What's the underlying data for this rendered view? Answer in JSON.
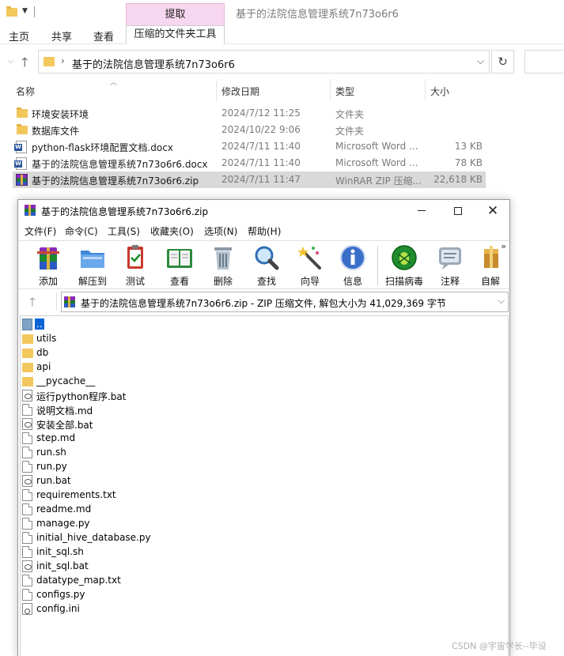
{
  "explorer": {
    "window_title": "基于的法院信息管理系统7n73o6r6",
    "context_tab": "提取",
    "ribbon_tabs": [
      "主页",
      "共享",
      "查看"
    ],
    "ribbon_active_tab": "压缩的文件夹工具",
    "address": "基于的法院信息管理系统7n73o6r6",
    "columns": {
      "name": "名称",
      "date": "修改日期",
      "type": "类型",
      "size": "大小"
    },
    "files": [
      {
        "name": "环境安装环境",
        "date": "2024/7/12 11:25",
        "type": "文件夹",
        "size": "",
        "icon": "folder-icon"
      },
      {
        "name": "数据库文件",
        "date": "2024/10/22 9:06",
        "type": "文件夹",
        "size": "",
        "icon": "folder-icon"
      },
      {
        "name": "python-flask环境配置文档.docx",
        "date": "2024/7/11 11:40",
        "type": "Microsoft Word ...",
        "size": "13 KB",
        "icon": "word-icon"
      },
      {
        "name": "基于的法院信息管理系统7n73o6r6.docx",
        "date": "2024/7/11 11:40",
        "type": "Microsoft Word ...",
        "size": "78 KB",
        "icon": "word-icon"
      },
      {
        "name": "基于的法院信息管理系统7n73o6r6.zip",
        "date": "2024/7/11 11:47",
        "type": "WinRAR ZIP 压缩...",
        "size": "22,618 KB",
        "icon": "winrar-icon",
        "selected": true
      }
    ]
  },
  "winrar": {
    "title": "基于的法院信息管理系统7n73o6r6.zip",
    "menu": [
      "文件(F)",
      "命令(C)",
      "工具(S)",
      "收藏夹(O)",
      "选项(N)",
      "帮助(H)"
    ],
    "toolbar": [
      {
        "label": "添加",
        "icon": "add-archive-icon"
      },
      {
        "label": "解压到",
        "icon": "extract-folder-icon"
      },
      {
        "label": "测试",
        "icon": "test-clipboard-icon"
      },
      {
        "label": "查看",
        "icon": "view-book-icon"
      },
      {
        "label": "删除",
        "icon": "trash-icon"
      },
      {
        "label": "查找",
        "icon": "magnifier-icon"
      },
      {
        "label": "向导",
        "icon": "wizard-wand-icon"
      },
      {
        "label": "信息",
        "icon": "info-icon"
      },
      {
        "label": "扫描病毒",
        "icon": "virus-scan-icon"
      },
      {
        "label": "注释",
        "icon": "comment-icon"
      },
      {
        "label": "自解",
        "icon": "sfx-icon"
      }
    ],
    "path": "基于的法院信息管理系统7n73o6r6.zip - ZIP 压缩文件, 解包大小为 41,029,369 字节",
    "entries": [
      {
        "name": "..",
        "kind": "up",
        "selected": true
      },
      {
        "name": "utils",
        "kind": "folder"
      },
      {
        "name": "db",
        "kind": "folder"
      },
      {
        "name": "api",
        "kind": "folder"
      },
      {
        "name": "__pycache__",
        "kind": "folder"
      },
      {
        "name": "运行python程序.bat",
        "kind": "bat"
      },
      {
        "name": "说明文档.md",
        "kind": "file"
      },
      {
        "name": "安装全部.bat",
        "kind": "bat"
      },
      {
        "name": "step.md",
        "kind": "file"
      },
      {
        "name": "run.sh",
        "kind": "file"
      },
      {
        "name": "run.py",
        "kind": "file"
      },
      {
        "name": "run.bat",
        "kind": "bat"
      },
      {
        "name": "requirements.txt",
        "kind": "file"
      },
      {
        "name": "readme.md",
        "kind": "file"
      },
      {
        "name": "manage.py",
        "kind": "file"
      },
      {
        "name": "initial_hive_database.py",
        "kind": "file"
      },
      {
        "name": "init_sql.sh",
        "kind": "file"
      },
      {
        "name": "init_sql.bat",
        "kind": "bat"
      },
      {
        "name": "datatype_map.txt",
        "kind": "file"
      },
      {
        "name": "configs.py",
        "kind": "file"
      },
      {
        "name": "config.ini",
        "kind": "ini"
      }
    ]
  },
  "watermark": "CSDN @宇宙学长--毕设"
}
